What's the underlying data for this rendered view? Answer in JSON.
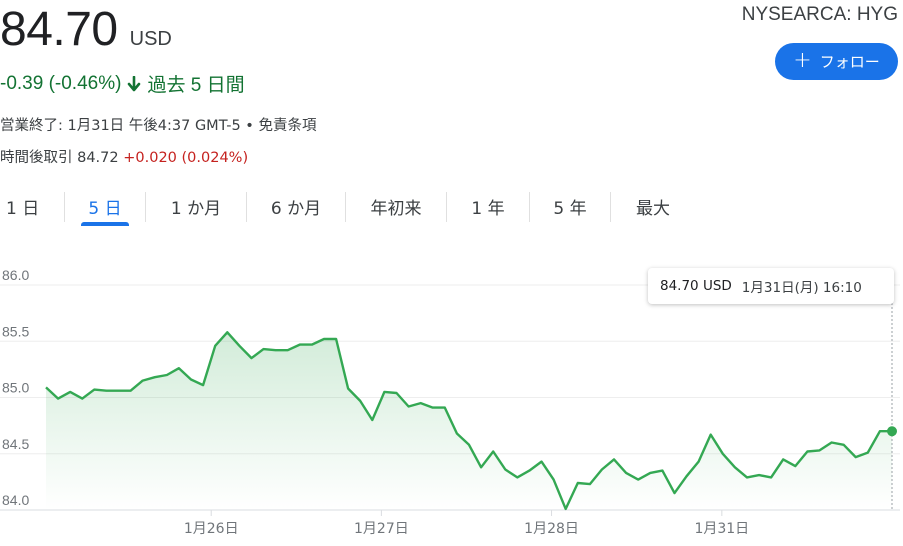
{
  "header": {
    "price": "84.70",
    "currency": "USD",
    "ticker": "NYSEARCA: HYG",
    "follow_label": "フォロー",
    "change": "-0.39 (-0.46%)",
    "period": "過去 5 日間",
    "close_info": "営業終了: 1月31日 午後4:37 GMT-5 •",
    "disclaimer": "免責条項",
    "after_hours_label": "時間後取引 84.72",
    "after_hours_change": "+0.020 (0.024%)"
  },
  "tabs": [
    {
      "label": "1 日",
      "active": false
    },
    {
      "label": "5 日",
      "active": true
    },
    {
      "label": "1 か月",
      "active": false
    },
    {
      "label": "6 か月",
      "active": false
    },
    {
      "label": "年初来",
      "active": false
    },
    {
      "label": "1 年",
      "active": false
    },
    {
      "label": "5 年",
      "active": false
    },
    {
      "label": "最大",
      "active": false
    }
  ],
  "tooltip": {
    "value": "84.70 USD",
    "date": "1月31日(月) 16:10"
  },
  "colors": {
    "line": "#34a853",
    "accent": "#1a73e8",
    "negative": "#137333",
    "positive": "#c5221f"
  },
  "chart_data": {
    "type": "area",
    "ylim": [
      84.0,
      86.0
    ],
    "yticks": [
      "86.0",
      "85.5",
      "85.0",
      "84.5",
      "84.0"
    ],
    "ytick_values": [
      86.0,
      85.5,
      85.0,
      84.5,
      84.0
    ],
    "xtick_labels": [
      "1月26日",
      "1月27日",
      "1月28日",
      "1月31日"
    ],
    "xtick_index": [
      13.67,
      27.75,
      41.83,
      55.92
    ],
    "grid": true,
    "series": [
      {
        "values": [
          85.09,
          84.99,
          85.05,
          84.99,
          85.07,
          85.06,
          85.06,
          85.06,
          85.15,
          85.18,
          85.2,
          85.26,
          85.16,
          85.11,
          85.46,
          85.58,
          85.46,
          85.35,
          85.43,
          85.42,
          85.42,
          85.47,
          85.47,
          85.52,
          85.52,
          85.08,
          84.97,
          84.8,
          85.05,
          85.04,
          84.92,
          84.95,
          84.91,
          84.91,
          84.68,
          84.58,
          84.38,
          84.52,
          84.36,
          84.29,
          84.35,
          84.43,
          84.27,
          84.01,
          84.24,
          84.23,
          84.36,
          84.45,
          84.33,
          84.27,
          84.33,
          84.35,
          84.15,
          84.3,
          84.43,
          84.67,
          84.5,
          84.38,
          84.29,
          84.31,
          84.29,
          84.45,
          84.39,
          84.52,
          84.53,
          84.6,
          84.58,
          84.47,
          84.51,
          84.7,
          84.7
        ]
      }
    ]
  }
}
